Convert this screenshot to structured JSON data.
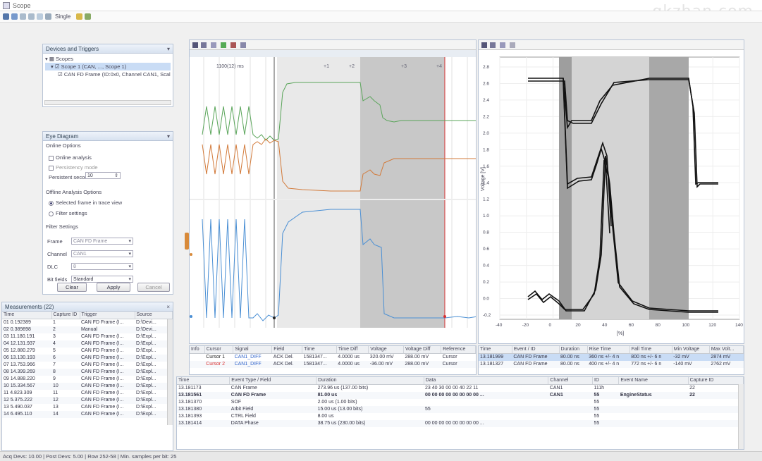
{
  "app": {
    "title": "Scope",
    "watermark": "gkzhan.com",
    "toolbar_scope_label": "Single"
  },
  "devices_panel": {
    "title": "Devices and Triggers",
    "tree": [
      "Scopes",
      "Scope 1 (CAN, ..., Scope 1)",
      "CAN FD Frame (ID:0x0, Channel CAN1, Scale ...)"
    ]
  },
  "eye_panel": {
    "title": "Eye Diagram",
    "online_options": "Online Options",
    "online_analysis": "Online analysis",
    "persistency_mode": "Persistency mode",
    "persistent_seconds_label": "Persistent seconds",
    "persistent_seconds_value": "10",
    "offline_options": "Offline Analysis Options",
    "selected_frame_label": "Selected frame in trace view",
    "filter_settings_label": "Filter settings",
    "filter_group": "Filter Settings",
    "frame_label": "Frame",
    "frame_value": "CAN FD Frame",
    "channel_label": "Channel",
    "channel_value": "CAN1",
    "dlc_label": "DLC",
    "dlc_value": "8",
    "bit_fields_label": "Bit fields",
    "bit_fields_value": "Standard",
    "clear_button": "Clear",
    "apply_button": "Apply",
    "cancel_button": "Cancel"
  },
  "measurements": {
    "title": "Measurements (22)",
    "columns": [
      "Time",
      "Capture ID",
      "Trigger",
      "Source"
    ],
    "rows": [
      [
        "01 0.192389",
        "1",
        "CAN FD Frame (I...",
        "D:\\Devi..."
      ],
      [
        "02 0.389898",
        "2",
        "Manual",
        "D:\\Devi..."
      ],
      [
        "03 11.180.191",
        "3",
        "CAN FD Frame (I...",
        "D:\\Expl..."
      ],
      [
        "04 12.131.937",
        "4",
        "CAN FD Frame (I...",
        "D:\\Expl..."
      ],
      [
        "05 12.880.279",
        "5",
        "CAN FD Frame (I...",
        "D:\\Expl..."
      ],
      [
        "06 13.130.193",
        "6",
        "CAN FD Frame (I...",
        "D:\\Expl..."
      ],
      [
        "07 13.753.966",
        "7",
        "CAN FD Frame (I...",
        "D:\\Expl..."
      ],
      [
        "08 14.399.269",
        "8",
        "CAN FD Frame (I...",
        "D:\\Expl..."
      ],
      [
        "09 14.888.220",
        "9",
        "CAN FD Frame (I...",
        "D:\\Expl..."
      ],
      [
        "10 15.334.567",
        "10",
        "CAN FD Frame (I...",
        "D:\\Expl..."
      ],
      [
        "11 4.823.309",
        "11",
        "CAN FD Frame (I...",
        "D:\\Expl..."
      ],
      [
        "12 5.375.222",
        "12",
        "CAN FD Frame (I...",
        "D:\\Expl..."
      ],
      [
        "13 5.490.037",
        "13",
        "CAN FD Frame (I...",
        "D:\\Expl..."
      ],
      [
        "14 6.495.110",
        "14",
        "CAN FD Frame (I...",
        "D:\\Expl..."
      ]
    ]
  },
  "scope_view": {
    "cursor_label": "1100(12) ms",
    "top_ticks": [
      "+1",
      "+2",
      "+3",
      "+4"
    ],
    "colors": {
      "green": "#5aa55a",
      "orange": "#d27a3a",
      "blue": "#4a8fd4",
      "cursor_red": "#d93030"
    }
  },
  "cursor_table": {
    "columns": [
      "Info",
      "Cursor",
      "Signal",
      "Field",
      "Time",
      "Time Diff",
      "Voltage",
      "Voltage Diff",
      "Reference"
    ],
    "rows": [
      [
        "",
        "Cursor 1",
        "CAN1_DIFF",
        "ACK Del.",
        "1581347...",
        "4.0000 us",
        "320.00 mV",
        "288.00 mV",
        "Cursor"
      ],
      [
        "",
        "Cursor 2",
        "CAN1_DIFF",
        "ACK Del.",
        "1581347...",
        "4.0000 us",
        "-36.00 mV",
        "288.00 mV",
        "Cursor"
      ]
    ]
  },
  "eye_chart": {
    "ylabel": "Voltage [V]",
    "xlabel": "[%]",
    "yticks": [
      "2.8",
      "2.6",
      "2.4",
      "2.2",
      "2.0",
      "1.8",
      "1.6",
      "1.4",
      "1.2",
      "1.0",
      "0.8",
      "0.6",
      "0.4",
      "0.2",
      "0.0",
      "-0.2"
    ],
    "xticks": [
      "-40",
      "-20",
      "0",
      "20",
      "40",
      "60",
      "80",
      "100",
      "120",
      "140"
    ]
  },
  "eye_table": {
    "columns": [
      "Time",
      "Event / ID",
      "Duration",
      "Rise Time",
      "Fall Time",
      "Min Voltage",
      "Max Volt..."
    ],
    "rows": [
      [
        "13.181999",
        "CAN FD Frame",
        "80.00 ns",
        "360 ns +/- 4 n",
        "800 ns +/- 6 n",
        "-32 mV",
        "2874 mV"
      ],
      [
        "13.181327",
        "CAN FD Frame",
        "80.00 ns",
        "400 ns +/- 4 n",
        "772 ns +/- 6 n",
        "-140 mV",
        "2762 mV"
      ]
    ]
  },
  "event_table": {
    "columns": [
      "Time",
      "Event Type / Field",
      "Duration",
      "Data",
      "Channel",
      "ID",
      "Event Name",
      "Capture ID"
    ],
    "rows": [
      [
        "13.181173",
        "CAN Frame",
        "273.96 us (137.00 bits)",
        "23 40 30 00 00 40 22 11",
        "CAN1",
        "111h",
        "",
        "22"
      ],
      [
        "13.181561",
        "CAN FD Frame",
        "81.00 us",
        "00 00 00 00 00 00 00 00 ...",
        "CAN1",
        "55",
        "EngineStatus",
        "22"
      ],
      [
        "13.181370",
        "SOF",
        "2.00 us (1.00 bits)",
        "",
        "",
        "55",
        "",
        ""
      ],
      [
        "13.181380",
        "Arbit Field",
        "15.00 us (13.00 bits)",
        "55",
        "",
        "55",
        "",
        ""
      ],
      [
        "13.181393",
        "CTRL Field",
        "8.00 us",
        "",
        "",
        "55",
        "",
        ""
      ],
      [
        "13.181414",
        "DATA Phase",
        "38.75 us (230.00 bits)",
        "00 00 00 00 00 00 00 00 ...",
        "",
        "55",
        "",
        ""
      ]
    ]
  },
  "status_bar": "Acq Devs: 10.00 | Post Devs: 5.00 | Row 252-58 | Min. samples per bit: 25"
}
